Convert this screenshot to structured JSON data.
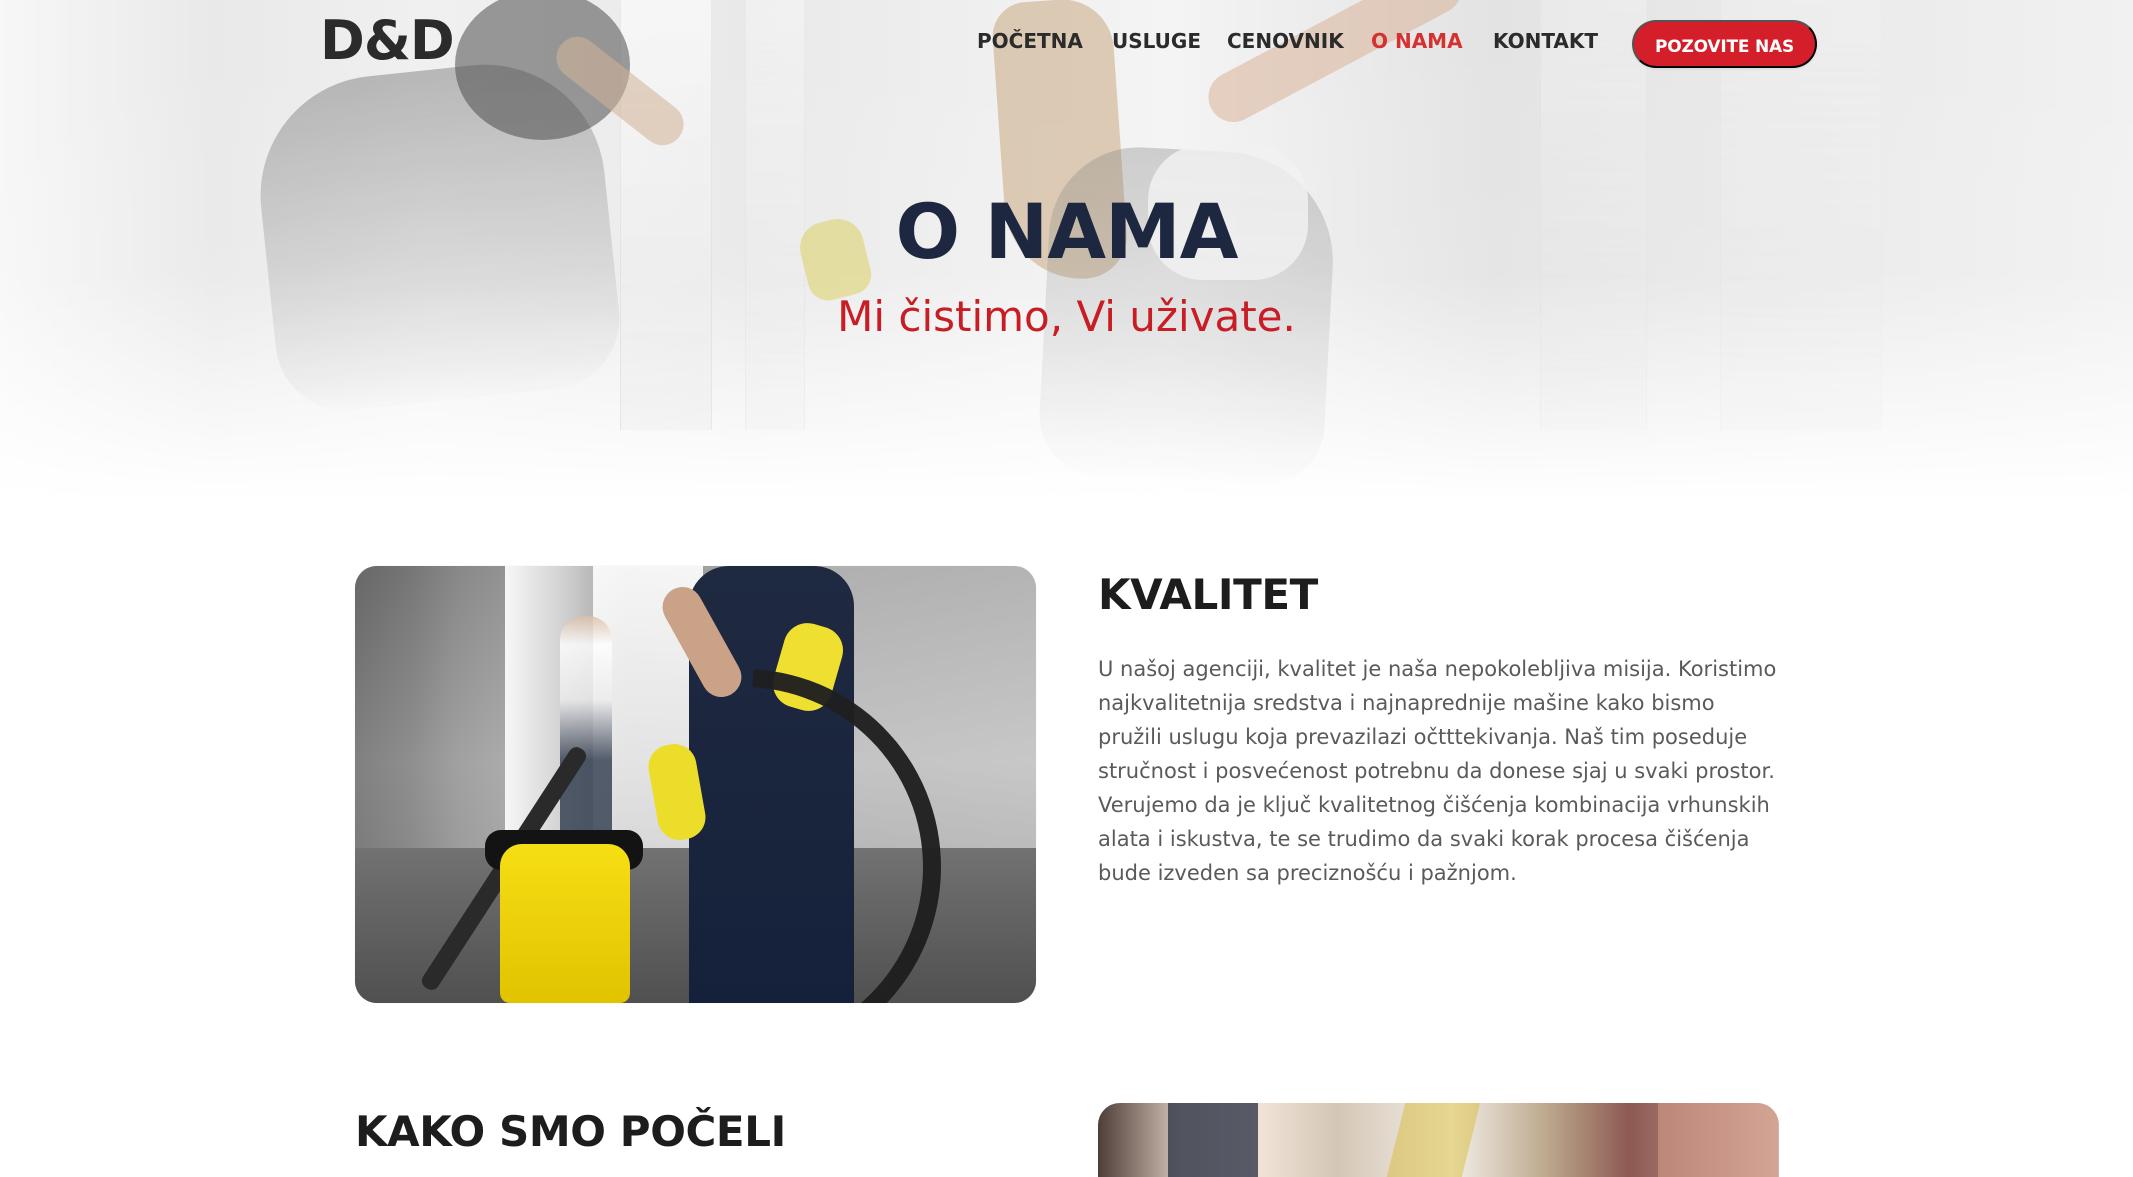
{
  "header": {
    "logo": "D&D",
    "nav": [
      {
        "label": "POČETNA"
      },
      {
        "label": "USLUGE"
      },
      {
        "label": "CENOVNIK"
      },
      {
        "label": "O NAMA",
        "active": true
      },
      {
        "label": "KONTAKT"
      }
    ],
    "cta": "POZOVITE NAS"
  },
  "hero": {
    "title": "O NAMA",
    "subtitle": "Mi čistimo, Vi uživate."
  },
  "section_quality": {
    "title": "KVALITET",
    "body": "U našoj agenciji, kvalitet je naša nepokolebljiva misija. Koristimo najkvalitetnija sredstva i najnaprednije mašine kako bismo pružili uslugu koja prevazilazi očtttekivanja. Naš tim poseduje stručnost i posvećenost potrebnu da donese sjaj u svaki prostor. Verujemo da je ključ kvalitetnog čišćenja kombinacija vrhunskih alata i iskustva, te se trudimo da svaki korak procesa čišćenja bude izveden sa preciznošću i pažnjom."
  },
  "section_history": {
    "title": "KAKO SMO POČELI"
  },
  "colors": {
    "accent": "#d41f2a",
    "active_nav": "#d63131",
    "heading": "#1d1d1d",
    "hero_title": "#1e2740",
    "hero_subtitle": "#c81d24",
    "body_text": "#5a5a5a"
  }
}
